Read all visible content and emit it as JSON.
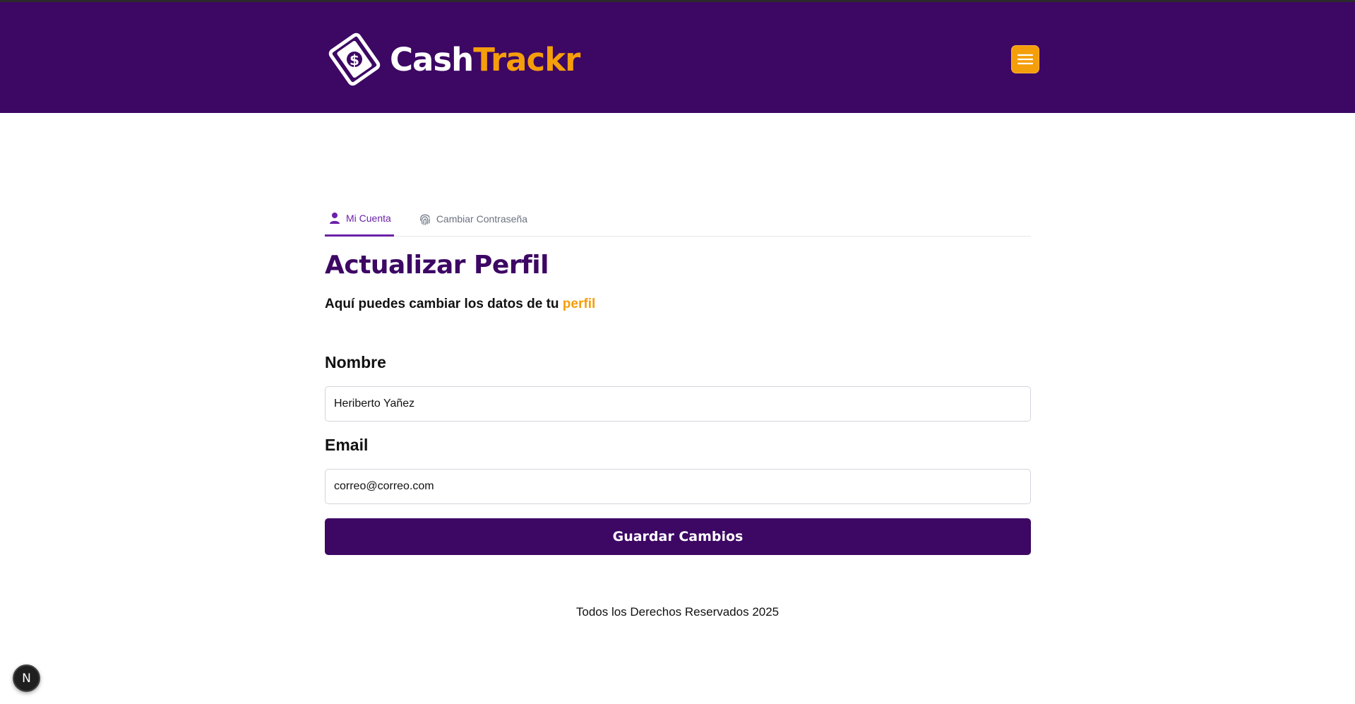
{
  "header": {
    "logo_word_1": "Cash",
    "logo_word_2": "Trackr",
    "background_color": "#3d0764",
    "accent_color": "#f59e0b",
    "menu_icon": "hamburger-menu-icon"
  },
  "tabs": [
    {
      "label": "Mi Cuenta",
      "icon": "user-icon",
      "active": true
    },
    {
      "label": "Cambiar Contraseña",
      "icon": "fingerprint-icon",
      "active": false
    }
  ],
  "page": {
    "title": "Actualizar Perfil",
    "subtitle_prefix": "Aquí puedes cambiar los datos de tu",
    "subtitle_accent": "perfil"
  },
  "form": {
    "name_label": "Nombre",
    "name_value": "Heriberto Yañez",
    "email_label": "Email",
    "email_value": "correo@correo.com",
    "submit_label": "Guardar Cambios"
  },
  "footer": {
    "text": "Todos los Derechos Reservados 2025"
  },
  "dev_badge": {
    "label": "N"
  }
}
